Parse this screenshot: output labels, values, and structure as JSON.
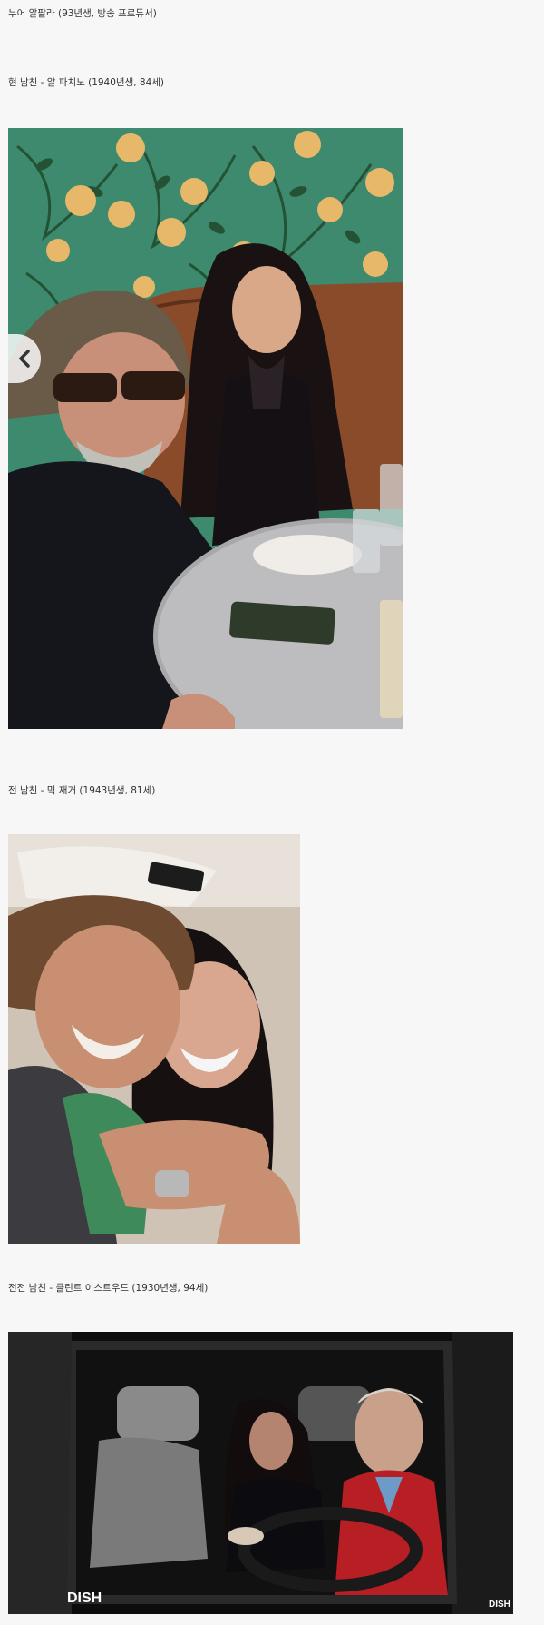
{
  "post": {
    "headline": "누어 알팔라 (93년생, 방송 프로듀서)",
    "sections": [
      {
        "caption": "현 남친 - 알 파치노 (1940년생, 84세)",
        "photo_alt": "알 파치노와 누어 알팔라"
      },
      {
        "caption": "전 남친 - 믹 재거 (1943년생, 81세)",
        "photo_alt": "믹 재거와 누어 알팔라"
      },
      {
        "caption": "전전 남친 - 클린트 이스트우드 (1930년생, 94세)",
        "photo_alt": "클린트 이스트우드와 누어 알팔라",
        "watermark_left": "DISH",
        "watermark_right": "DISH"
      }
    ]
  },
  "controls": {
    "prev_icon": "chevron-left-icon"
  },
  "colors": {
    "background": "#f7f7f7",
    "text": "#333333",
    "wallpaper": "#3d8a6e"
  }
}
